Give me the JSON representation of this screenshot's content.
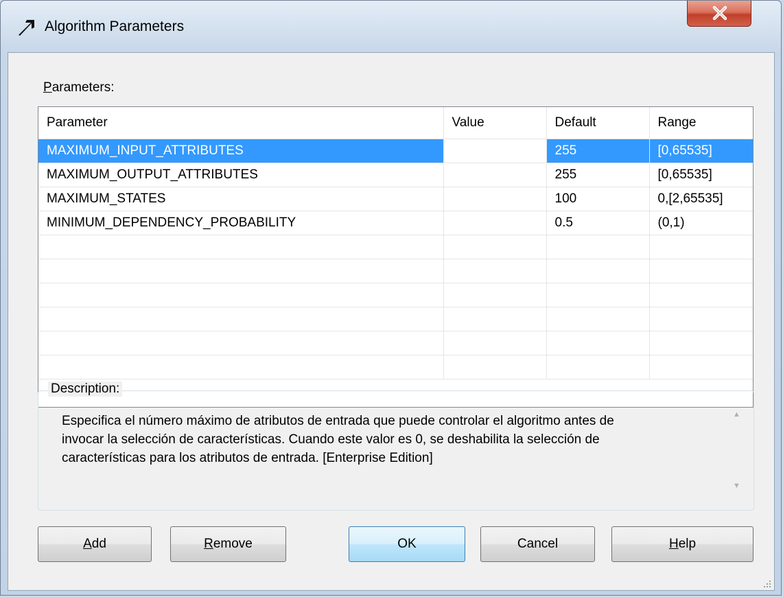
{
  "window": {
    "title": "Algorithm Parameters",
    "icon": "arrow-icon",
    "close_label": "X"
  },
  "parameters_label": {
    "accel": "P",
    "rest": "arameters:"
  },
  "grid": {
    "columns": [
      "Parameter",
      "Value",
      "Default",
      "Range"
    ],
    "rows": [
      {
        "parameter": "MAXIMUM_INPUT_ATTRIBUTES",
        "value": "",
        "default": "255",
        "range": "[0,65535]",
        "selected": true
      },
      {
        "parameter": "MAXIMUM_OUTPUT_ATTRIBUTES",
        "value": "",
        "default": "255",
        "range": "[0,65535]"
      },
      {
        "parameter": "MAXIMUM_STATES",
        "value": "",
        "default": "100",
        "range": "0,[2,65535]"
      },
      {
        "parameter": "MINIMUM_DEPENDENCY_PROBABILITY",
        "value": "",
        "default": "0.5",
        "range": "(0,1)"
      }
    ]
  },
  "description": {
    "legend": "Description:",
    "lines": [
      "Especifica el número máximo de atributos de entrada que puede controlar el algoritmo antes de",
      "invocar la selección de características. Cuando este valor es 0, se deshabilita la selección de",
      "características para los atributos de entrada. [Enterprise Edition]"
    ]
  },
  "buttons": {
    "add": {
      "accel": "A",
      "rest": "dd"
    },
    "remove": {
      "accel": "R",
      "rest": "emove"
    },
    "ok": "OK",
    "cancel": "Cancel",
    "help": {
      "accel": "H",
      "rest": "elp"
    }
  },
  "colors": {
    "selection": "#3399ff",
    "ok_border": "#3c7fb1",
    "close_red": "#c0402a"
  }
}
